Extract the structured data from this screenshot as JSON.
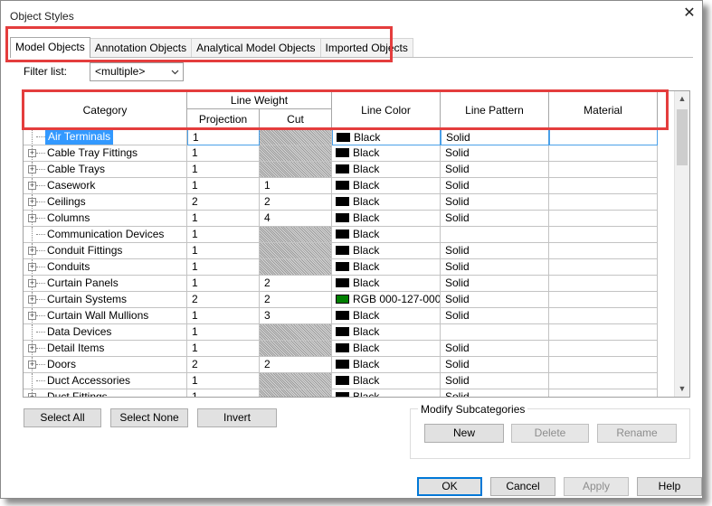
{
  "window": {
    "title": "Object Styles",
    "close_glyph": "✕"
  },
  "tabs": [
    {
      "label": "Model Objects",
      "active": true
    },
    {
      "label": "Annotation Objects",
      "active": false
    },
    {
      "label": "Analytical Model Objects",
      "active": false
    },
    {
      "label": "Imported Objects",
      "active": false
    }
  ],
  "filter": {
    "label": "Filter list:",
    "value": "<multiple>"
  },
  "grid": {
    "headers": {
      "category": "Category",
      "line_weight": "Line Weight",
      "projection": "Projection",
      "cut": "Cut",
      "line_color": "Line Color",
      "line_pattern": "Line Pattern",
      "material": "Material"
    },
    "rows": [
      {
        "category": "Air Terminals",
        "expandable": false,
        "projection": "1",
        "cut": "",
        "cut_na": true,
        "color_name": "Black",
        "color_hex": "#000000",
        "pattern": "Solid",
        "material": "",
        "selected": true
      },
      {
        "category": "Cable Tray Fittings",
        "expandable": true,
        "projection": "1",
        "cut": "",
        "cut_na": true,
        "color_name": "Black",
        "color_hex": "#000000",
        "pattern": "Solid",
        "material": ""
      },
      {
        "category": "Cable Trays",
        "expandable": true,
        "projection": "1",
        "cut": "",
        "cut_na": true,
        "color_name": "Black",
        "color_hex": "#000000",
        "pattern": "Solid",
        "material": ""
      },
      {
        "category": "Casework",
        "expandable": true,
        "projection": "1",
        "cut": "1",
        "cut_na": false,
        "color_name": "Black",
        "color_hex": "#000000",
        "pattern": "Solid",
        "material": ""
      },
      {
        "category": "Ceilings",
        "expandable": true,
        "projection": "2",
        "cut": "2",
        "cut_na": false,
        "color_name": "Black",
        "color_hex": "#000000",
        "pattern": "Solid",
        "material": ""
      },
      {
        "category": "Columns",
        "expandable": true,
        "projection": "1",
        "cut": "4",
        "cut_na": false,
        "color_name": "Black",
        "color_hex": "#000000",
        "pattern": "Solid",
        "material": ""
      },
      {
        "category": "Communication Devices",
        "expandable": false,
        "projection": "1",
        "cut": "",
        "cut_na": true,
        "color_name": "Black",
        "color_hex": "#000000",
        "pattern": "",
        "material": ""
      },
      {
        "category": "Conduit Fittings",
        "expandable": true,
        "projection": "1",
        "cut": "",
        "cut_na": true,
        "color_name": "Black",
        "color_hex": "#000000",
        "pattern": "Solid",
        "material": ""
      },
      {
        "category": "Conduits",
        "expandable": true,
        "projection": "1",
        "cut": "",
        "cut_na": true,
        "color_name": "Black",
        "color_hex": "#000000",
        "pattern": "Solid",
        "material": ""
      },
      {
        "category": "Curtain Panels",
        "expandable": true,
        "projection": "1",
        "cut": "2",
        "cut_na": false,
        "color_name": "Black",
        "color_hex": "#000000",
        "pattern": "Solid",
        "material": ""
      },
      {
        "category": "Curtain Systems",
        "expandable": true,
        "projection": "2",
        "cut": "2",
        "cut_na": false,
        "color_name": "RGB 000-127-000",
        "color_hex": "#007f00",
        "pattern": "Solid",
        "material": ""
      },
      {
        "category": "Curtain Wall Mullions",
        "expandable": true,
        "projection": "1",
        "cut": "3",
        "cut_na": false,
        "color_name": "Black",
        "color_hex": "#000000",
        "pattern": "Solid",
        "material": ""
      },
      {
        "category": "Data Devices",
        "expandable": false,
        "projection": "1",
        "cut": "",
        "cut_na": true,
        "color_name": "Black",
        "color_hex": "#000000",
        "pattern": "",
        "material": ""
      },
      {
        "category": "Detail Items",
        "expandable": true,
        "projection": "1",
        "cut": "",
        "cut_na": true,
        "color_name": "Black",
        "color_hex": "#000000",
        "pattern": "Solid",
        "material": ""
      },
      {
        "category": "Doors",
        "expandable": true,
        "projection": "2",
        "cut": "2",
        "cut_na": false,
        "color_name": "Black",
        "color_hex": "#000000",
        "pattern": "Solid",
        "material": ""
      },
      {
        "category": "Duct Accessories",
        "expandable": false,
        "projection": "1",
        "cut": "",
        "cut_na": true,
        "color_name": "Black",
        "color_hex": "#000000",
        "pattern": "Solid",
        "material": ""
      },
      {
        "category": "Duct Fittings",
        "expandable": true,
        "projection": "1",
        "cut": "",
        "cut_na": true,
        "color_name": "Black",
        "color_hex": "#000000",
        "pattern": "Solid",
        "material": ""
      }
    ]
  },
  "selection_buttons": {
    "select_all": "Select All",
    "select_none": "Select None",
    "invert": "Invert"
  },
  "modify_subcategories": {
    "title": "Modify Subcategories",
    "new": "New",
    "delete": "Delete",
    "rename": "Rename"
  },
  "dialog_buttons": {
    "ok": "OK",
    "cancel": "Cancel",
    "apply": "Apply",
    "help": "Help"
  },
  "colors": {
    "highlight_box": "#e43d3d",
    "selection": "#3399ff",
    "accent": "#0078d7"
  }
}
